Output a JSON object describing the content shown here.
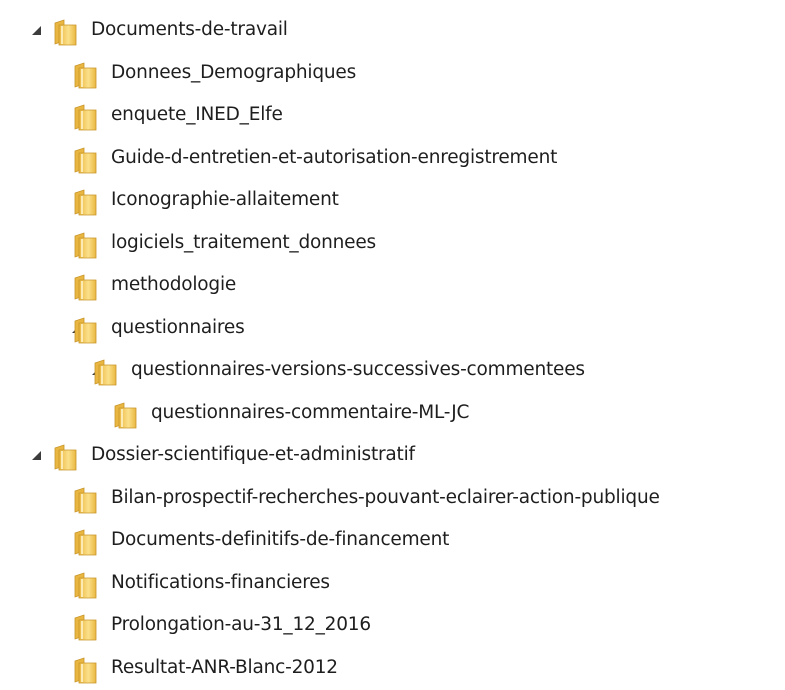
{
  "tree": [
    {
      "label": "Documents-de-travail",
      "level": 0,
      "expanded": true,
      "icon": "folder-icon"
    },
    {
      "label": "Donnees_Demographiques",
      "level": 1,
      "expanded": false,
      "icon": "folder-icon"
    },
    {
      "label": "enquete_INED_Elfe",
      "level": 1,
      "expanded": false,
      "icon": "folder-icon"
    },
    {
      "label": "Guide-d-entretien-et-autorisation-enregistrement",
      "level": 1,
      "expanded": false,
      "icon": "folder-icon"
    },
    {
      "label": "Iconographie-allaitement",
      "level": 1,
      "expanded": false,
      "icon": "folder-icon"
    },
    {
      "label": "logiciels_traitement_donnees",
      "level": 1,
      "expanded": false,
      "icon": "folder-icon"
    },
    {
      "label": "methodologie",
      "level": 1,
      "expanded": false,
      "icon": "folder-icon"
    },
    {
      "label": "questionnaires",
      "level": 1,
      "expanded": true,
      "icon": "folder-icon"
    },
    {
      "label": "questionnaires-versions-successives-commentees",
      "level": 2,
      "expanded": true,
      "icon": "folder-icon"
    },
    {
      "label": "questionnaires-commentaire-ML-JC",
      "level": 3,
      "expanded": false,
      "icon": "folder-icon"
    },
    {
      "label": "Dossier-scientifique-et-administratif",
      "level": 0,
      "expanded": true,
      "icon": "folder-icon"
    },
    {
      "label": "Bilan-prospectif-recherches-pouvant-eclairer-action-publique",
      "level": 1,
      "expanded": false,
      "icon": "folder-icon"
    },
    {
      "label": "Documents-definitifs-de-financement",
      "level": 1,
      "expanded": false,
      "icon": "folder-icon"
    },
    {
      "label": "Notifications-financieres",
      "level": 1,
      "expanded": false,
      "icon": "folder-icon"
    },
    {
      "label": "Prolongation-au-31_12_2016",
      "level": 1,
      "expanded": false,
      "icon": "folder-icon"
    },
    {
      "label": "Resultat-ANR-Blanc-2012",
      "level": 1,
      "expanded": false,
      "icon": "folder-icon"
    }
  ],
  "colors": {
    "folder_light": "#fbe08a",
    "folder_dark": "#e9b741",
    "folder_edge": "#c8952a",
    "arrow": "#3c3c3c",
    "text": "#1e1e1e"
  }
}
